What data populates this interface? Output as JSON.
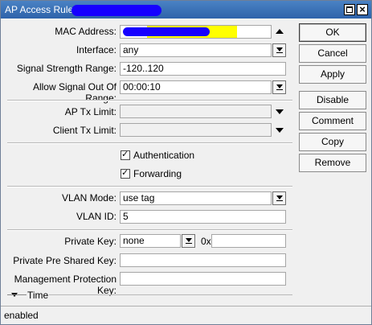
{
  "window": {
    "title": "AP Access Rule"
  },
  "fields": {
    "mac_address": {
      "label": "MAC Address:",
      "value": ""
    },
    "interface": {
      "label": "Interface:",
      "value": "any"
    },
    "signal_range": {
      "label": "Signal Strength Range:",
      "value": "-120..120"
    },
    "allow_signal_out": {
      "label": "Allow Signal Out Of Range:",
      "value": "00:00:10"
    },
    "ap_tx_limit": {
      "label": "AP Tx Limit:",
      "value": ""
    },
    "client_tx_limit": {
      "label": "Client Tx Limit:",
      "value": ""
    },
    "authentication": {
      "label": "Authentication",
      "checked": true
    },
    "forwarding": {
      "label": "Forwarding",
      "checked": true
    },
    "vlan_mode": {
      "label": "VLAN Mode:",
      "value": "use tag"
    },
    "vlan_id": {
      "label": "VLAN ID:",
      "value": "5"
    },
    "private_key": {
      "label": "Private Key:",
      "value": "none",
      "hex_prefix": "0x",
      "hex_value": ""
    },
    "private_psk": {
      "label": "Private Pre Shared Key:",
      "value": ""
    },
    "mgmt_protection_key": {
      "label": "Management Protection Key:",
      "value": ""
    },
    "time_section": {
      "label": "Time"
    }
  },
  "buttons": {
    "ok": "OK",
    "cancel": "Cancel",
    "apply": "Apply",
    "disable": "Disable",
    "comment": "Comment",
    "copy": "Copy",
    "remove": "Remove"
  },
  "status": {
    "text": "enabled"
  },
  "colors": {
    "titlebar": "#2e63aa",
    "redaction": "#1600ff",
    "highlight": "#ffff00"
  }
}
